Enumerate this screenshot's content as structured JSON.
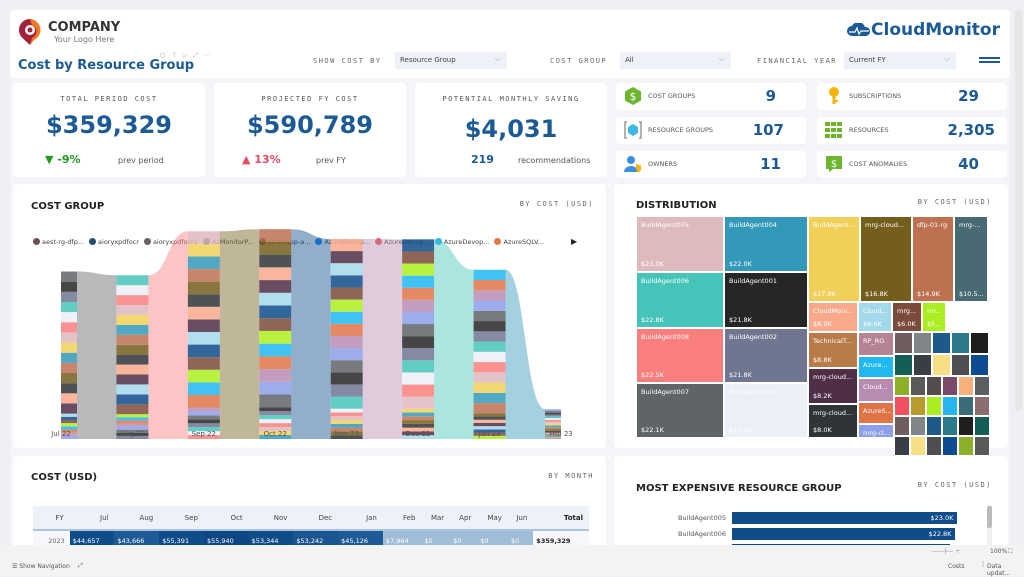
{
  "header": {
    "logo_company": "COMPANY",
    "logo_tagline": "Your Logo Here",
    "page_title": "Cost by Resource Group",
    "brand": "CloudMonitor",
    "filters": [
      {
        "label": "SHOW COST BY",
        "value": "Resource Group"
      },
      {
        "label": "COST GROUP",
        "value": "All"
      },
      {
        "label": "FINANCIAL YEAR",
        "value": "Current FY"
      }
    ]
  },
  "kpis": [
    {
      "label": "TOTAL PERIOD COST",
      "value": "$359,329",
      "delta": "▼ -9%",
      "delta_color": "#1f9a1f",
      "note": "prev period"
    },
    {
      "label": "PROJECTED FY COST",
      "value": "$590,789",
      "delta": "▲ 13%",
      "delta_color": "#e84a5f",
      "note": "prev FY"
    },
    {
      "label": "POTENTIAL MONTHLY SAVING",
      "value": "$4,031",
      "delta": "219",
      "delta_color": "#1b5a96",
      "note": "recommendations"
    }
  ],
  "stats": [
    {
      "label": "COST GROUPS",
      "value": "9",
      "icon": "dollar-hexagon-icon"
    },
    {
      "label": "SUBSCRIPTIONS",
      "value": "29",
      "icon": "key-icon"
    },
    {
      "label": "RESOURCE GROUPS",
      "value": "107",
      "icon": "resource-group-cube-icon"
    },
    {
      "label": "RESOURCES",
      "value": "2,305",
      "icon": "grid-icon"
    },
    {
      "label": "OWNERS",
      "value": "11",
      "icon": "user-shield-icon"
    },
    {
      "label": "COST ANOMALIES",
      "value": "40",
      "icon": "dollar-alert-icon"
    }
  ],
  "cost_group": {
    "title": "COST GROUP",
    "subtitle": "BY COST (USD)",
    "legend": [
      {
        "name": "aest-rg-dfp...",
        "color": "#6e5050"
      },
      {
        "name": "aioryxpdfocr",
        "color": "#1f4e6e"
      },
      {
        "name": "aioryxpdfocr2",
        "color": "#6d6060"
      },
      {
        "name": "AzMonitorP...",
        "color": "#0f4c8a"
      },
      {
        "name": "azureapp-a...",
        "color": "#18405e"
      },
      {
        "name": "AzureDevop...",
        "color": "#1e90ff"
      },
      {
        "name": "AzureDevop...",
        "color": "#f0505f"
      },
      {
        "name": "AzureDevop...",
        "color": "#27b5f0"
      },
      {
        "name": "AzureSQLV...",
        "color": "#e0784a"
      }
    ],
    "months": [
      "Jul 22",
      "Aug 22",
      "Sep 22",
      "Oct 22",
      "Nov 22",
      "Dec 22",
      "Jan 23",
      "Feb 23"
    ]
  },
  "chart_data": [
    {
      "type": "area",
      "title": "COST GROUP",
      "subtitle": "BY COST (USD)",
      "x": [
        "Jul 22",
        "Aug 22",
        "Sep 22",
        "Oct 22",
        "Nov 22",
        "Dec 22",
        "Jan 23",
        "Feb 23"
      ],
      "series_total": [
        44657,
        43666,
        55391,
        55940,
        53344,
        53242,
        45126,
        7964
      ],
      "note": "ribbon chart, stacked by resource group"
    },
    {
      "type": "heatmap",
      "title": "DISTRIBUTION",
      "subtitle": "BY COST (USD)",
      "cells": [
        {
          "name": "BuildAgent005",
          "value": "$23.0K",
          "color": "#deb9bd"
        },
        {
          "name": "BuildAgent004",
          "value": "$22.0K",
          "color": "#3499b8"
        },
        {
          "name": "BuildAgent...",
          "value": "$17.9K",
          "color": "#f1d05a"
        },
        {
          "name": "mrg-cloud...",
          "value": "$16.8K",
          "color": "#735e1c"
        },
        {
          "name": "dfp-01-rg",
          "value": "$14.9K",
          "color": "#bd7151"
        },
        {
          "name": "mrg-...",
          "value": "$10.5...",
          "color": "#476a73"
        },
        {
          "name": "BuildAgent006",
          "value": "$22.8K",
          "color": "#47c4b9"
        },
        {
          "name": "BuildAgent001",
          "value": "$21.8K",
          "color": "#262626"
        },
        {
          "name": "CloudMoni...",
          "value": "$8.9K",
          "color": "#f9a98b"
        },
        {
          "name": "Cloud...",
          "value": "$6.6K",
          "color": "#a3d9ea"
        },
        {
          "name": "mrg...",
          "value": "$6.0K",
          "color": "#7a4a3a"
        },
        {
          "name": "mr...",
          "value": "$5...",
          "color": "#abee1f"
        },
        {
          "name": "BuildAgent008",
          "value": "$22.5K",
          "color": "#f97f7e"
        },
        {
          "name": "BuildAgent002",
          "value": "$21.8K",
          "color": "#6f7690"
        },
        {
          "name": "TechnicalT...",
          "value": "$8.8K",
          "color": "#b97c49"
        },
        {
          "name": "RP_RG",
          "value": "",
          "color": "#b58395"
        },
        {
          "name": "Azure...",
          "value": "",
          "color": "#1fb8f0"
        },
        {
          "name": "Cloud...",
          "value": "",
          "color": "#b88cb1"
        },
        {
          "name": "AzureS...",
          "value": "",
          "color": "#e07447"
        },
        {
          "name": "mrg-cl...",
          "value": "",
          "color": "#8c9fe8"
        },
        {
          "name": "mrg-cloud...",
          "value": "$8.2K",
          "color": "#4f2f48"
        },
        {
          "name": "mrg-cloud...",
          "value": "$8.0K",
          "color": "#2f3437"
        },
        {
          "name": "BuildAgent007",
          "value": "$22.1K",
          "color": "#5f6466"
        },
        {
          "name": "BuildAgent003",
          "value": "$21.3K",
          "color": "#eceff7"
        }
      ]
    },
    {
      "type": "bar",
      "title": "MOST EXPENSIVE RESOURCE GROUP",
      "subtitle": "BY COST (USD)",
      "categories": [
        "BuildAgent005",
        "BuildAgent006"
      ],
      "values": [
        23.0,
        22.8
      ],
      "labels": [
        "$23.0K",
        "$22.8K"
      ],
      "unit": "K USD",
      "xlim": [
        0,
        25
      ]
    }
  ],
  "distribution": {
    "title": "DISTRIBUTION",
    "subtitle": "BY COST (USD)"
  },
  "cost_table": {
    "title": "COST (USD)",
    "subtitle": "BY MONTH",
    "headers": [
      "FY",
      "Jul",
      "Aug",
      "Sep",
      "Oct",
      "Nov",
      "Dec",
      "Jan",
      "Feb",
      "Mar",
      "Apr",
      "May",
      "Jun",
      "Total"
    ],
    "row": [
      "2023",
      "$44,657",
      "$43,666",
      "$55,391",
      "$55,940",
      "$53,344",
      "$53,242",
      "$45,126",
      "$7,964",
      "$0",
      "$0",
      "$0",
      "$0",
      "$359,329"
    ]
  },
  "top_rg": {
    "title": "MOST EXPENSIVE RESOURCE GROUP",
    "subtitle": "BY COST (USD)"
  },
  "status_bar": {
    "show_nav": "Show Navigation",
    "zoom": "100%",
    "page": "Costs",
    "data_updated": "Data updat..."
  }
}
